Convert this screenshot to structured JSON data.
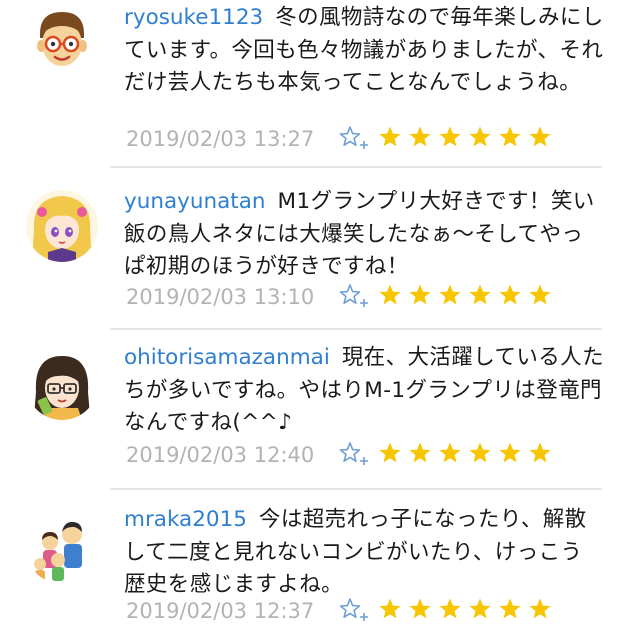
{
  "colors": {
    "username": "#2f7fd0",
    "body_text": "#1a1a1a",
    "timestamp": "#b3b3b3",
    "star_fill": "#f7c600",
    "fav_outline": "#6f9fd8",
    "divider": "#e6e6e6"
  },
  "comments": [
    {
      "avatar_icon": "glasses-boy-avatar-icon",
      "username": "ryosuke1123",
      "text": "冬の風物詩なので毎年楽しみにしています。今回も色々物議がありましたが、それだけ芸人たちも本気ってことなんでしょうね。",
      "timestamp": "2019/02/03 13:27",
      "fav_icon": "star-plus-icon",
      "rating": 6
    },
    {
      "avatar_icon": "blonde-girl-avatar-icon",
      "username": "yunayunatan",
      "text": "M1グランプリ大好きです！笑い飯の鳥人ネタには大爆笑したなぁ〜そしてやっぱ初期のほうが好きですね！",
      "timestamp": "2019/02/03 13:10",
      "fav_icon": "star-plus-icon",
      "rating": 6
    },
    {
      "avatar_icon": "glasses-woman-avatar-icon",
      "username": "ohitorisamazanmai",
      "text": "現在、大活躍している人たちが多いですね。やはりM-1グランプリは登竜門なんですね(^^♪",
      "timestamp": "2019/02/03 12:40",
      "fav_icon": "star-plus-icon",
      "rating": 6
    },
    {
      "avatar_icon": "family-avatar-icon",
      "username": "mraka2015",
      "text": "今は超売れっ子になったり、解散して二度と見れないコンビがいたり、けっこう歴史を感じますよね。",
      "timestamp": "2019/02/03 12:37",
      "fav_icon": "star-plus-icon",
      "rating": 6
    }
  ]
}
